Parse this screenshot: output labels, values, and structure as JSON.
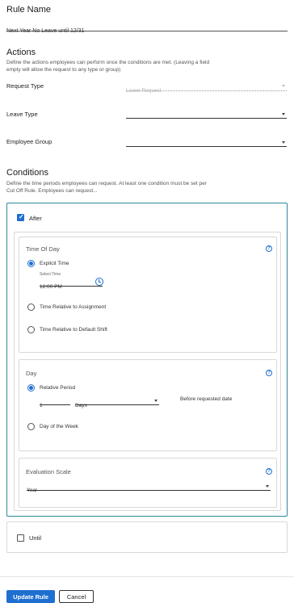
{
  "rule_name": {
    "heading": "Rule Name",
    "value": "Next Year No Leave until 12/31"
  },
  "actions": {
    "heading": "Actions",
    "description_line1": "Define the actions employees can perform once the conditions are met. (Leaving a field",
    "description_line2": "empty will allow the request to any type or group)",
    "request_type": {
      "label": "Request Type",
      "placeholder": "Leave Request"
    },
    "leave_type": {
      "label": "Leave Type",
      "value": ""
    },
    "employee_group": {
      "label": "Employee Group",
      "value": ""
    }
  },
  "conditions": {
    "heading": "Conditions",
    "description_line1": "Define the time periods employees can request. At least one condition must be set per",
    "description_line2": "Cut Off Rule. Employees can request...",
    "after": {
      "label": "After",
      "checked": true,
      "time_of_day": {
        "title": "Time Of Day",
        "explicit_time": "Explicit Time",
        "select_time_label": "Select Time",
        "select_time_value": "12:00 PM",
        "relative_assignment": "Time Relative to Assignment",
        "relative_default_shift": "Time Relative to Default Shift"
      },
      "day": {
        "title": "Day",
        "relative_period": "Relative Period",
        "period_value": "1",
        "period_unit": "Days",
        "suffix": "Before requested date",
        "day_of_week": "Day of the Week"
      },
      "evaluation_scale": {
        "title": "Evaluation Scale",
        "value": "Year"
      }
    },
    "until": {
      "label": "Until",
      "checked": false
    }
  },
  "footer": {
    "update_label": "Update Rule",
    "cancel_label": "Cancel"
  },
  "icons": {
    "help": "?",
    "check": "✓"
  },
  "colors": {
    "accent": "#1f6fd1",
    "panel_border": "#2b8a9a"
  }
}
